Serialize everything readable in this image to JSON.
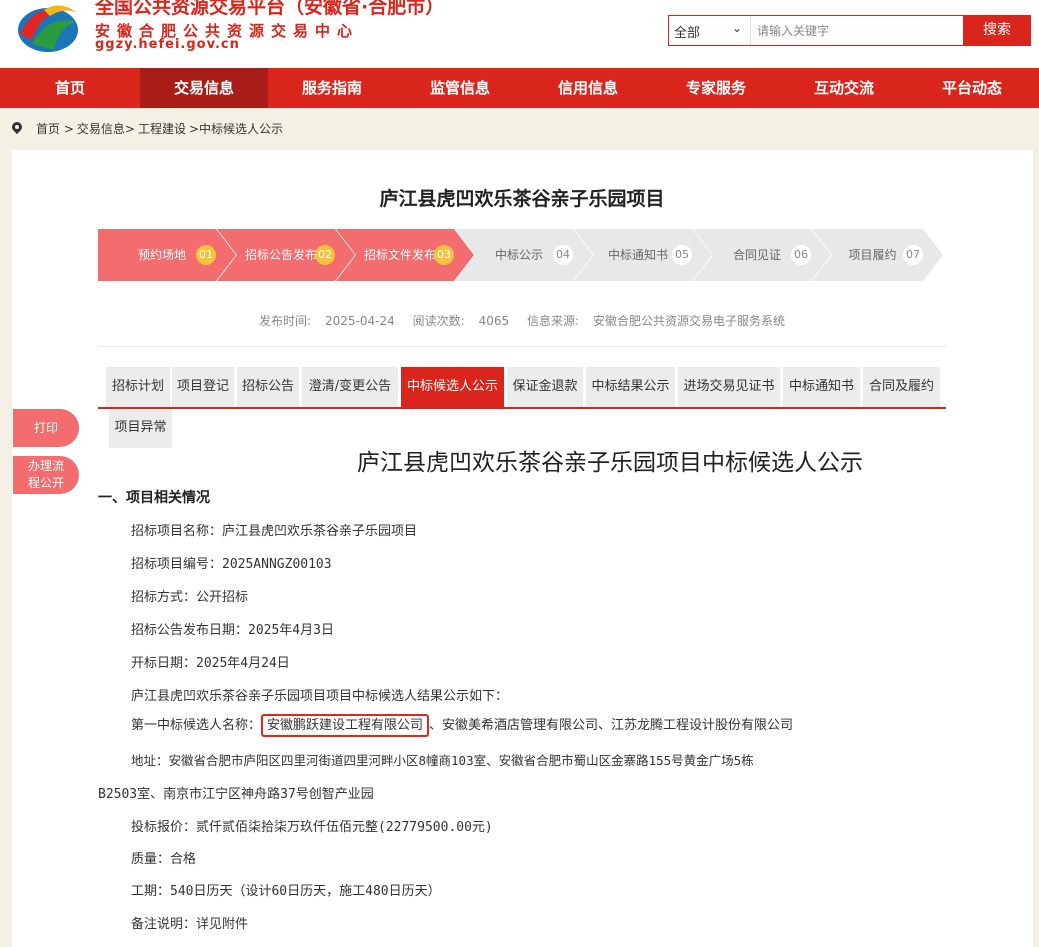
{
  "header": {
    "platform_title": "全国公共资源交易平台（安徽省·合肥市）",
    "center_name": "安徽合肥公共资源交易中心",
    "url": "ggzy.hefei.gov.cn",
    "top_strip_text": "…",
    "search": {
      "category": "全部",
      "placeholder": "请输入关键字",
      "button": "搜索"
    }
  },
  "nav": [
    "首页",
    "交易信息",
    "服务指南",
    "监管信息",
    "信用信息",
    "专家服务",
    "互动交流",
    "平台动态"
  ],
  "breadcrumb": [
    "首页 >",
    "交易信息>",
    "工程建设",
    ">中标候选人公示"
  ],
  "project_title": "庐江县虎凹欢乐茶谷亲子乐园项目",
  "steps": [
    {
      "label": "预约场地",
      "num": "01",
      "done": true
    },
    {
      "label": "招标公告发布",
      "num": "02",
      "done": true
    },
    {
      "label": "招标文件发布",
      "num": "03",
      "done": true
    },
    {
      "label": "中标公示",
      "num": "04",
      "done": false
    },
    {
      "label": "中标通知书",
      "num": "05",
      "done": false
    },
    {
      "label": "合同见证",
      "num": "06",
      "done": false
    },
    {
      "label": "项目履约",
      "num": "07",
      "done": false
    }
  ],
  "meta": {
    "publish_label": "发布时间:",
    "publish_date": "2025-04-24",
    "reads_label": "阅读次数:",
    "reads": "4065",
    "source_label": "信息来源:",
    "source": "安徽合肥公共资源交易电子服务系统"
  },
  "tabs": [
    "招标计划",
    "项目登记",
    "招标公告",
    "澄清/变更公告",
    "中标候选人公示",
    "保证金退款",
    "中标结果公示",
    "进场交易见证书",
    "中标通知书",
    "合同及履约",
    "项目异常"
  ],
  "side": {
    "print": "打印",
    "process_line1": "办理流",
    "process_line2": "程公开"
  },
  "doc": {
    "title": "庐江县虎凹欢乐茶谷亲子乐园项目中标候选人公示",
    "section1": "一、项目相关情况",
    "l1": "招标项目名称：庐江县虎凹欢乐茶谷亲子乐园项目",
    "l2": "招标项目编号：2025ANNGZ00103",
    "l3": "招标方式：公开招标",
    "l4": "招标公告发布日期：2025年4月3日",
    "l5": "开标日期：2025年4月24日",
    "l6": "庐江县虎凹欢乐茶谷亲子乐园项目项目中标候选人结果公示如下：",
    "l7_label": "第一中标候选人名称：",
    "l7_highlight": "安徽鹏跃建设工程有限公司",
    "l7_rest": "、安徽美希酒店管理有限公司、江苏龙腾工程设计股份有限公司",
    "l8": "地址：安徽省合肥市庐阳区四里河街道四里河畔小区8幢商103室、安徽省合肥市蜀山区金寨路155号黄金广场5栋",
    "l8b": "B2503室、南京市江宁区神舟路37号创智产业园",
    "l9": "投标报价：贰仟贰佰柒拾柒万玖仟伍佰元整(22779500.00元)",
    "l10": "质量：合格",
    "l11": "工期：540日历天（设计60日历天，施工480日历天）",
    "l12": "备注说明：详见附件"
  }
}
